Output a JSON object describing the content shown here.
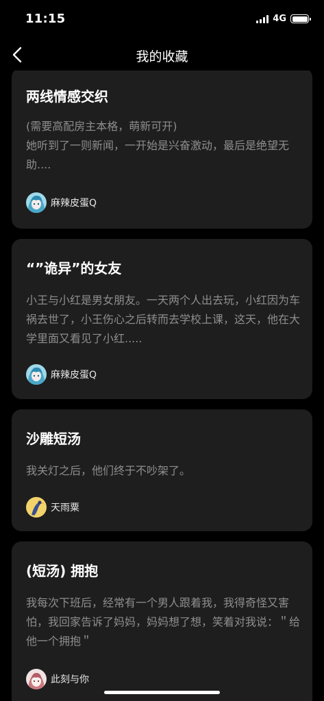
{
  "status_bar": {
    "time": "11:15",
    "network": "4G"
  },
  "nav": {
    "title": "我的收藏"
  },
  "cards": [
    {
      "title": "两线情感交织",
      "description": "(需要高配房主本格，萌新可开)\n她听到了一则新闻，一开始是兴奋激动，最后是绝望无助....",
      "author": "麻辣皮蛋Q"
    },
    {
      "title": "“”诡异”的女友",
      "description": "小王与小红是男女朋友。一天两个人出去玩，小红因为车祸去世了，小王伤心之后转而去学校上课，这天，他在大学里面又看见了小红.....",
      "author": "麻辣皮蛋Q"
    },
    {
      "title": "沙雕短汤",
      "description": "我关灯之后，他们终于不吵架了。",
      "author": "天雨粟"
    },
    {
      "title": "(短汤) 拥抱",
      "description": "我每次下班后，经常有一个男人跟着我，我得奇怪又害怕，我回家告诉了妈妈，妈妈想了想，笑着对我说：＂给他一个拥抱＂",
      "author": "此刻与你"
    }
  ],
  "colors": {
    "background": "#000000",
    "card": "#1e1e1e",
    "text_secondary": "#8e8e8e"
  }
}
